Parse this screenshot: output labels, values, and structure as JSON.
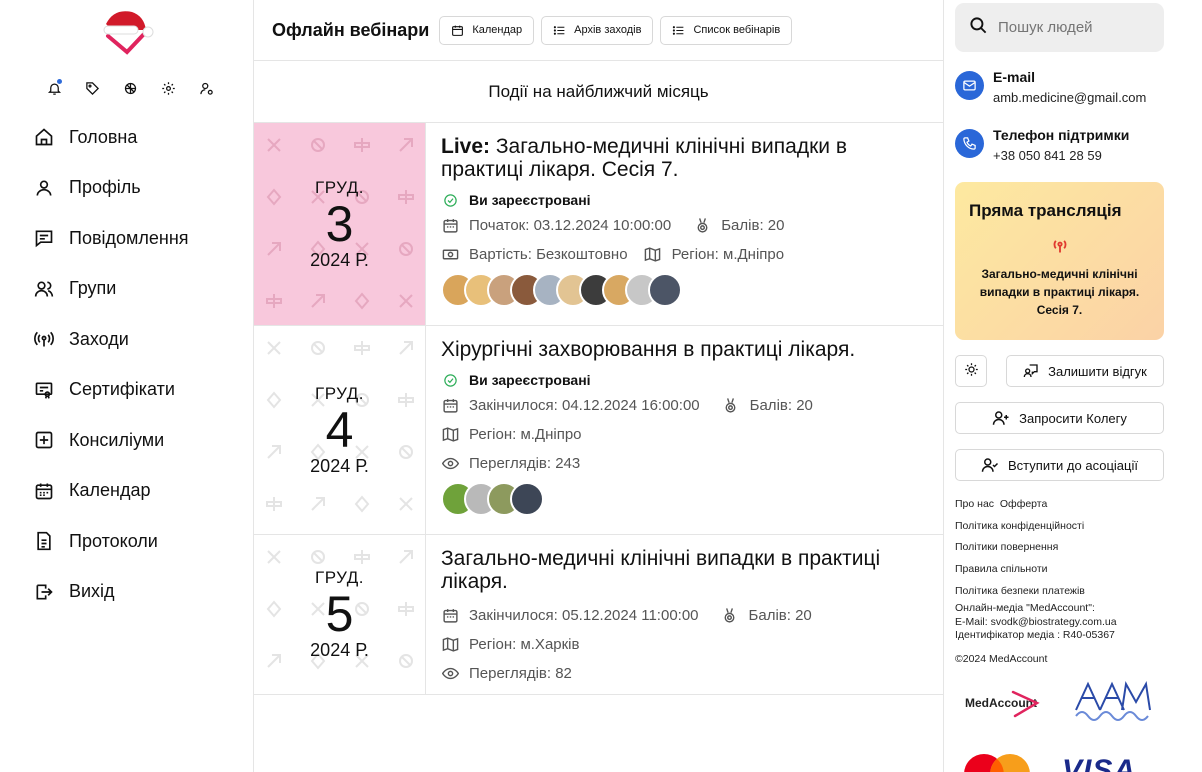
{
  "sidebar": {
    "logo_icon": "santa-hat-logo-icon",
    "quick_icons": [
      "bell-icon",
      "tag-icon",
      "openai-icon",
      "gear-icon",
      "user-settings-icon"
    ],
    "items": [
      {
        "label": "Головна",
        "icon": "home-icon"
      },
      {
        "label": "Профіль",
        "icon": "user-icon"
      },
      {
        "label": "Повідомлення",
        "icon": "message-icon"
      },
      {
        "label": "Групи",
        "icon": "users-icon"
      },
      {
        "label": "Заходи",
        "icon": "broadcast-icon"
      },
      {
        "label": "Сертифікати",
        "icon": "certificate-icon"
      },
      {
        "label": "Консиліуми",
        "icon": "plus-square-icon"
      },
      {
        "label": "Календар",
        "icon": "calendar-icon"
      },
      {
        "label": "Протоколи",
        "icon": "document-icon"
      },
      {
        "label": "Вихід",
        "icon": "logout-icon"
      }
    ]
  },
  "header": {
    "title": "Офлайн вебінари",
    "buttons": [
      {
        "label": "Календар",
        "icon": "calendar-icon"
      },
      {
        "label": "Архів заходів",
        "icon": "list-icon"
      },
      {
        "label": "Список вебінарів",
        "icon": "list-icon"
      }
    ]
  },
  "main": {
    "section_title": "Події на найближчий місяць",
    "events": [
      {
        "live": true,
        "live_label": "Live:",
        "month": "ГРУД.",
        "day": "3",
        "year": "2024 Р.",
        "title": "Загально-медичні клінічні випадки в практиці лікаря. Сесія 7.",
        "registered": "Ви зареєстровані",
        "start": "Початок: 03.12.2024 10:00:00",
        "points": "Балів: 20",
        "cost": "Вартість: Безкоштовно",
        "region": "Регіон: м.Дніпро",
        "avatar_count": 9
      },
      {
        "live": false,
        "month": "ГРУД.",
        "day": "4",
        "year": "2024 Р.",
        "title": "Хірургічні захворювання в практиці лікаря.",
        "registered": "Ви зареєстровані",
        "ended": "Закінчилося: 04.12.2024 16:00:00",
        "points": "Балів: 20",
        "region": "Регіон: м.Дніпро",
        "views": "Переглядів: 243",
        "avatar_count": 4
      },
      {
        "live": false,
        "month": "ГРУД.",
        "day": "5",
        "year": "2024 Р.",
        "title": "Загально-медичні клінічні випадки в практиці лікаря.",
        "ended": "Закінчилося: 05.12.2024 11:00:00",
        "points": "Балів: 20",
        "region": "Регіон: м.Харків",
        "views": "Переглядів: 82"
      }
    ]
  },
  "right": {
    "search_placeholder": "Пошук людей",
    "email_title": "E-mail",
    "email_value": "amb.medicine@gmail.com",
    "phone_title": "Телефон підтримки",
    "phone_value": "+38 050 841 28 59",
    "live_title": "Пряма трансляція",
    "live_text": "Загально-медичні клінічні випадки в практиці лікаря. Сесія 7.",
    "feedback_label": "Залишити відгук",
    "invite_label": "Запросити Колегу",
    "join_label": "Вступити до асоціації",
    "links": [
      "Про нас",
      "Офферта",
      "Політика конфіденційності",
      "Політики повернення",
      "Правила спільноти",
      "Політика безпеки платежів"
    ],
    "legal": [
      "Онлайн-медіа \"MedAccount\":",
      "E-Mail: svodk@biostrategy.com.ua",
      "Ідентифікатор медіа : R40-05367"
    ],
    "copyright": "©2024 MedAccount",
    "brand_logo_text": "MedAccount",
    "visa_text": "VISA",
    "accent_color": "#2a67d8",
    "live_color": "#f8c8dc"
  }
}
